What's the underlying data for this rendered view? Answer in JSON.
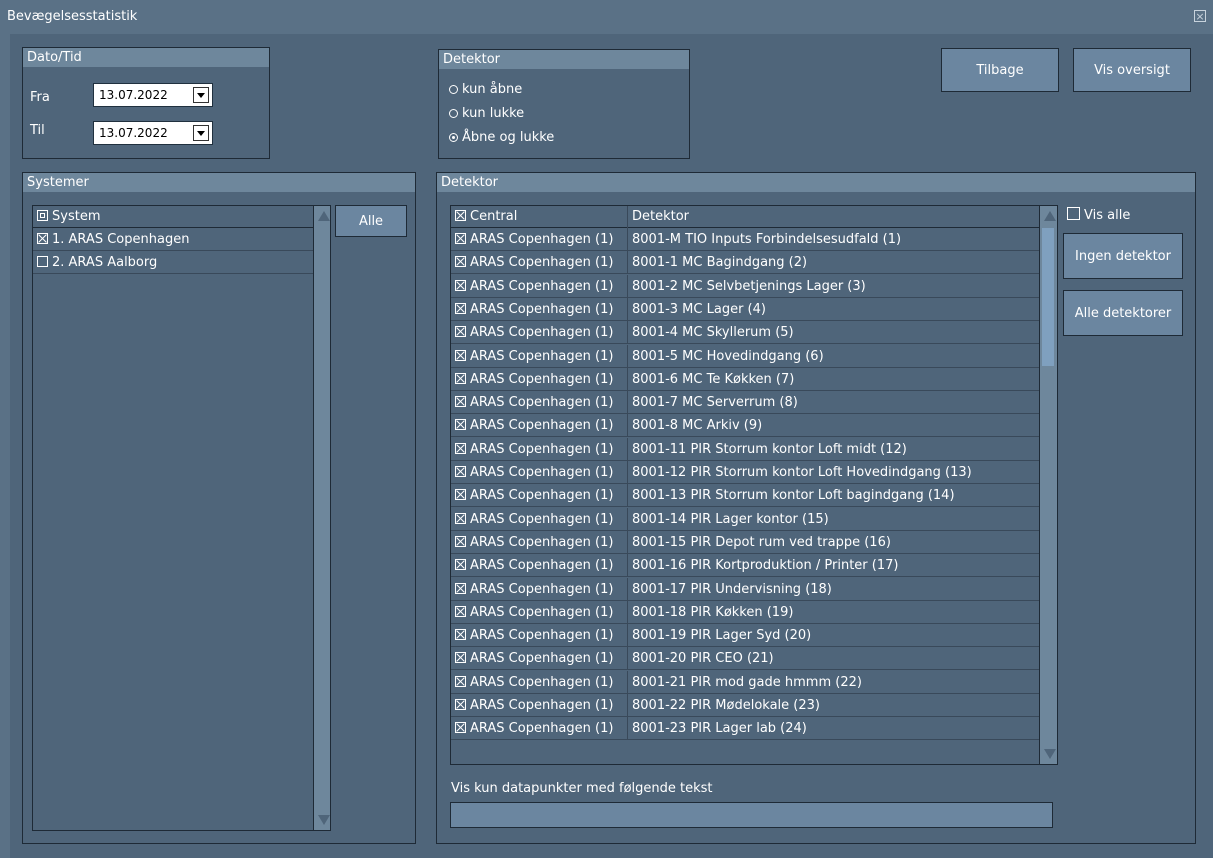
{
  "window": {
    "title": "Bevægelsesstatistik",
    "close_glyph": "×"
  },
  "datetime": {
    "header": "Dato/Tid",
    "from_label": "Fra",
    "from_value": "13.07.2022",
    "to_label": "Til",
    "to_value": "13.07.2022"
  },
  "detector_filter": {
    "header": "Detektor",
    "options": [
      "kun åbne",
      "kun lukke",
      "Åbne og lukke"
    ],
    "selected_index": 2
  },
  "buttons": {
    "back": "Tilbage",
    "overview": "Vis oversigt",
    "all_systems": "Alle",
    "no_detector": "Ingen detektor",
    "all_detectors": "Alle detektorer"
  },
  "systems": {
    "header": "Systemer",
    "column": "System",
    "items": [
      {
        "label": "1. ARAS Copenhagen",
        "checked": true
      },
      {
        "label": "2. ARAS Aalborg",
        "checked": false
      }
    ]
  },
  "detectors": {
    "header": "Detektor",
    "col_central": "Central",
    "col_detector": "Detektor",
    "show_all_label": "Vis alle",
    "rows": [
      {
        "central": "ARAS Copenhagen (1)",
        "detector": "8001-M TIO Inputs Forbindelsesudfald (1)"
      },
      {
        "central": "ARAS Copenhagen (1)",
        "detector": "8001-1 MC Bagindgang (2)"
      },
      {
        "central": "ARAS Copenhagen (1)",
        "detector": "8001-2 MC Selvbetjenings Lager (3)"
      },
      {
        "central": "ARAS Copenhagen (1)",
        "detector": "8001-3 MC Lager (4)"
      },
      {
        "central": "ARAS Copenhagen (1)",
        "detector": "8001-4 MC Skyllerum (5)"
      },
      {
        "central": "ARAS Copenhagen (1)",
        "detector": "8001-5 MC Hovedindgang (6)"
      },
      {
        "central": "ARAS Copenhagen (1)",
        "detector": "8001-6 MC Te Køkken (7)"
      },
      {
        "central": "ARAS Copenhagen (1)",
        "detector": "8001-7 MC Serverrum (8)"
      },
      {
        "central": "ARAS Copenhagen (1)",
        "detector": "8001-8 MC Arkiv (9)"
      },
      {
        "central": "ARAS Copenhagen (1)",
        "detector": "8001-11 PIR Storrum kontor Loft midt (12)"
      },
      {
        "central": "ARAS Copenhagen (1)",
        "detector": "8001-12 PIR Storrum kontor Loft Hovedindgang (13)"
      },
      {
        "central": "ARAS Copenhagen (1)",
        "detector": "8001-13 PIR Storrum kontor Loft bagindgang (14)"
      },
      {
        "central": "ARAS Copenhagen (1)",
        "detector": "8001-14 PIR Lager kontor (15)"
      },
      {
        "central": "ARAS Copenhagen (1)",
        "detector": "8001-15 PIR Depot rum ved trappe (16)"
      },
      {
        "central": "ARAS Copenhagen (1)",
        "detector": "8001-16 PIR Kortproduktion /  Printer (17)"
      },
      {
        "central": "ARAS Copenhagen (1)",
        "detector": "8001-17 PIR Undervisning (18)"
      },
      {
        "central": "ARAS Copenhagen (1)",
        "detector": "8001-18 PIR Køkken (19)"
      },
      {
        "central": "ARAS Copenhagen (1)",
        "detector": "8001-19 PIR Lager Syd (20)"
      },
      {
        "central": "ARAS Copenhagen (1)",
        "detector": "8001-20 PIR CEO (21)"
      },
      {
        "central": "ARAS Copenhagen (1)",
        "detector": "8001-21 PIR mod gade hmmm (22)"
      },
      {
        "central": "ARAS Copenhagen (1)",
        "detector": "8001-22 PIR Mødelokale (23)"
      },
      {
        "central": "ARAS Copenhagen (1)",
        "detector": "8001-23 PIR Lager lab (24)"
      }
    ]
  },
  "text_filter": {
    "label": "Vis kun datapunkter med følgende tekst",
    "value": ""
  }
}
